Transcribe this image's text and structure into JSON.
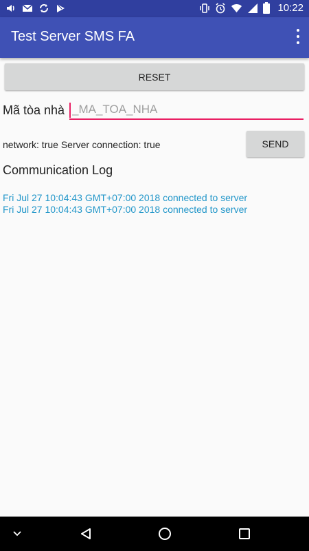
{
  "status_bar": {
    "time": "10:22",
    "left_icons": [
      "volume-icon",
      "gmail-icon",
      "sync-icon",
      "play-store-icon"
    ],
    "right_icons": [
      "vibrate-icon",
      "alarm-icon",
      "wifi-icon",
      "signal-icon",
      "battery-icon"
    ]
  },
  "app_bar": {
    "title": "Test Server SMS FA",
    "overflow_icon": "more-vert-icon"
  },
  "main": {
    "reset_label": "RESET",
    "building_label": "Mã tòa nhà",
    "building_input": {
      "value": "",
      "placeholder": "_MA_TOA_NHA"
    },
    "connection_status": "network: true Server connection: true",
    "send_label": "SEND",
    "log_title": "Communication Log",
    "log_entries": [
      "Fri Jul 27 10:04:43 GMT+07:00 2018 connected to server",
      "Fri Jul 27 10:04:43 GMT+07:00 2018 connected to server"
    ]
  },
  "nav_bar": {
    "icons": [
      "keyboard-hide-icon",
      "back-icon",
      "home-icon",
      "recents-icon"
    ]
  },
  "colors": {
    "status_bar": "#303f9f",
    "app_bar": "#3f51b5",
    "accent": "#e91e63",
    "log_text": "#2196c9"
  }
}
